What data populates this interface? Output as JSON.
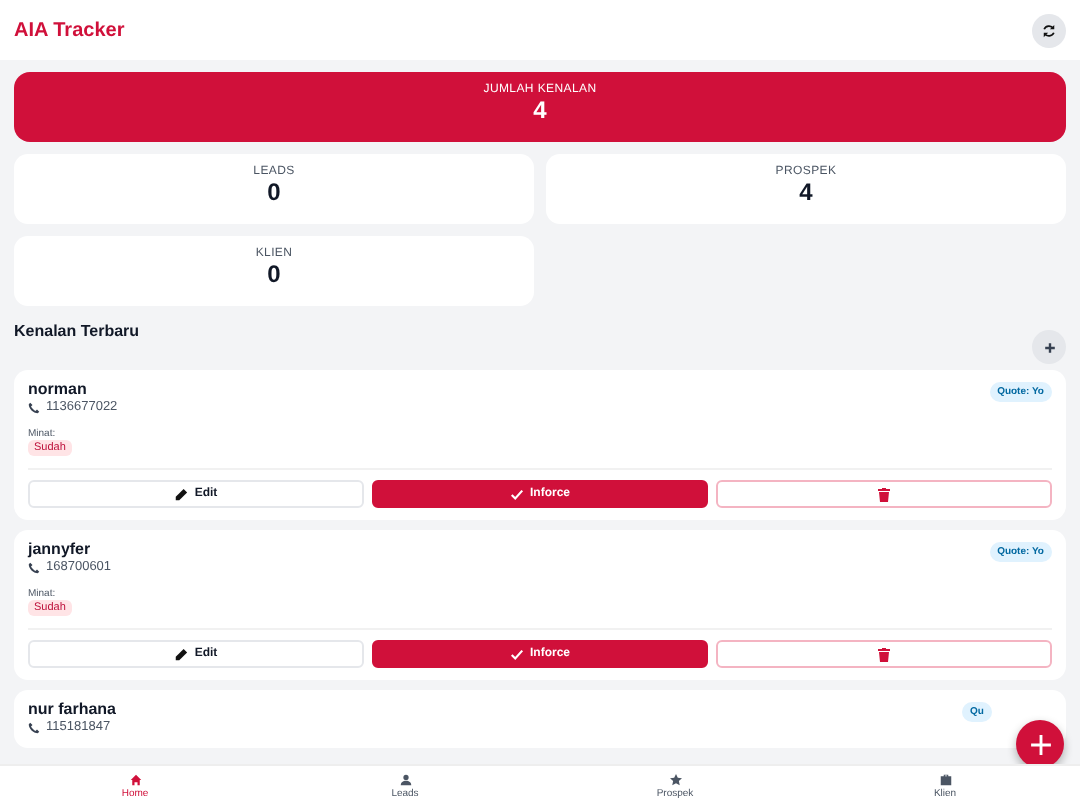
{
  "header": {
    "title": "AIA Tracker"
  },
  "summary": {
    "label": "JUMLAH KENALAN",
    "value": "4"
  },
  "stats": [
    {
      "label": "LEADS",
      "value": "0"
    },
    {
      "label": "PROSPEK",
      "value": "4"
    },
    {
      "label": "KLIEN",
      "value": "0"
    }
  ],
  "section_title": "Kenalan Terbaru",
  "contacts": [
    {
      "name": "norman",
      "phone": "1136677022",
      "badge": "Quote: Yo",
      "minat_label": "Minat:",
      "minat": "Sudah",
      "edit": "Edit",
      "inforce": "Inforce"
    },
    {
      "name": "jannyfer",
      "phone": "168700601",
      "badge": "Quote: Yo",
      "minat_label": "Minat:",
      "minat": "Sudah",
      "edit": "Edit",
      "inforce": "Inforce"
    },
    {
      "name": "nur farhana",
      "phone": "115181847",
      "badge": "Qu"
    }
  ],
  "bottom_nav": [
    {
      "label": "Home",
      "selected": true
    },
    {
      "label": "Leads",
      "selected": false
    },
    {
      "label": "Prospek",
      "selected": false
    },
    {
      "label": "Klien",
      "selected": false
    }
  ]
}
